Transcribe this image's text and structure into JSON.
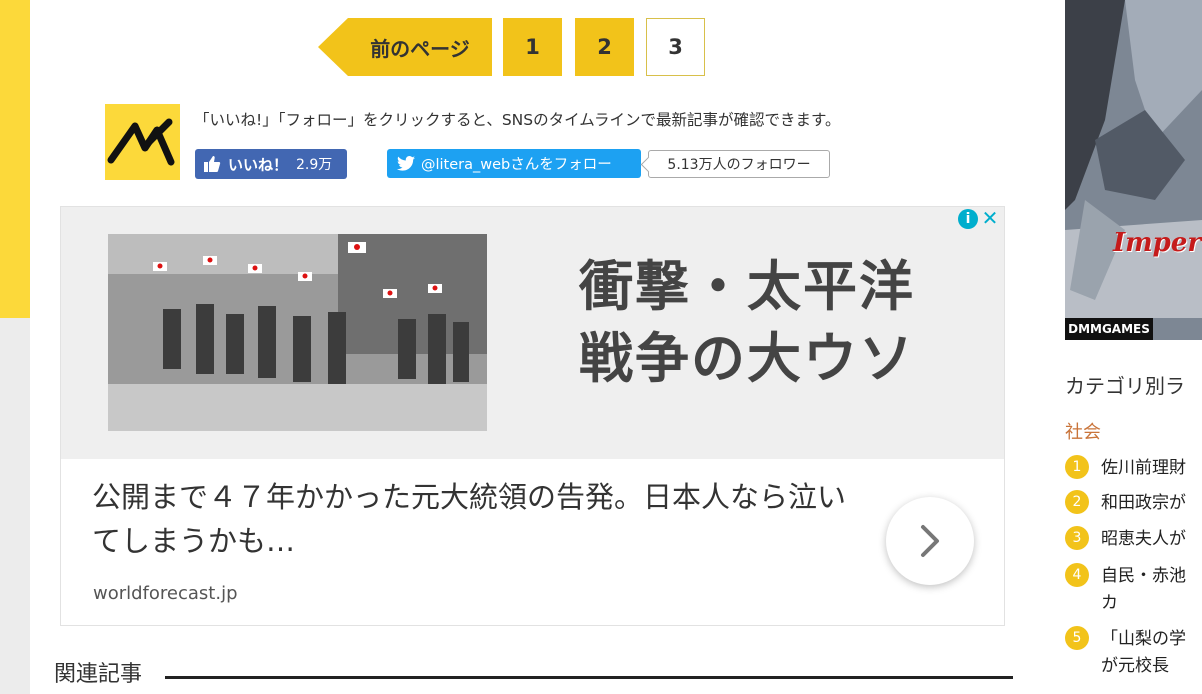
{
  "pagination": {
    "prev_label": "前のページ",
    "pages": [
      "1",
      "2",
      "3"
    ],
    "current": "3"
  },
  "follow": {
    "text": "「いいね!」「フォロー」をクリックすると、SNSのタイムラインで最新記事が確認できます。",
    "fb_like_label": "いいね！",
    "fb_like_count": "2.9万",
    "twitter_follow_label": "@litera_webさんをフォロー",
    "twitter_follower_count": "5.13万人のフォロワー"
  },
  "ad": {
    "headline_line1": "衝撃・太平洋",
    "headline_line2": "戦争の大ウソ",
    "description": "公開まで４７年かかった元大統領の告発。日本人なら泣いてしまうかも…",
    "domain": "worldforecast.jp",
    "info_icon": "i",
    "close_icon": "✕"
  },
  "related": {
    "heading": "関連記事"
  },
  "sidebar": {
    "ad_brand": "DMMGAMES",
    "ad_game_title": "Imperial S",
    "category_title": "カテゴリ別ラ",
    "category_sub": "社会",
    "ranking": [
      {
        "num": "1",
        "text": "佐川前理財"
      },
      {
        "num": "2",
        "text": "和田政宗が"
      },
      {
        "num": "3",
        "text": "昭恵夫人が"
      },
      {
        "num": "4",
        "text": "自民・赤池",
        "text2": "カ"
      },
      {
        "num": "5",
        "text": "「山梨の学",
        "text2": "が元校長"
      }
    ]
  },
  "colors": {
    "accent_yellow": "#f2c31a",
    "facebook_blue": "#4267b2",
    "twitter_blue": "#1da1f2",
    "adchoices_cyan": "#00aecd"
  }
}
